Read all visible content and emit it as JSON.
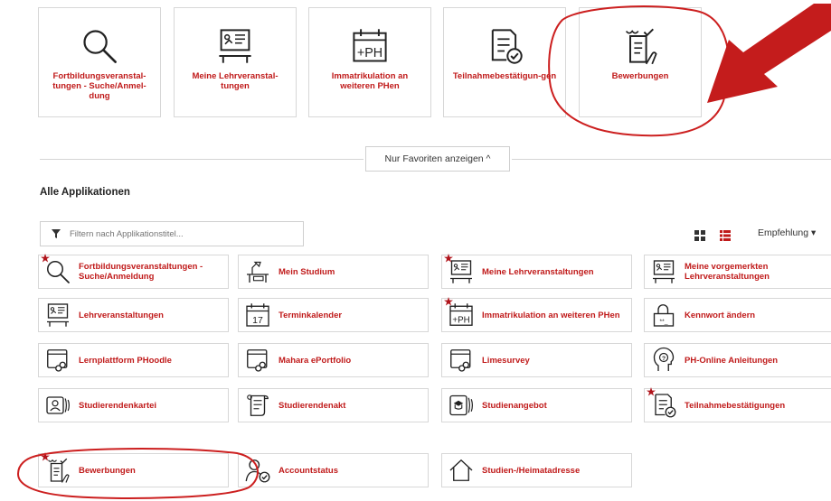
{
  "favorites": [
    {
      "label": "Fortbildungsveranstal-tungen - Suche/Anmel-dung",
      "icon": "magnifier-icon"
    },
    {
      "label": "Meine Lehrveranstal-tungen",
      "icon": "lecture-board-icon"
    },
    {
      "label": "Immatrikulation an weiteren PHen",
      "icon": "plus-ph-calendar-icon"
    },
    {
      "label": "Teilnahmebestätigun-gen",
      "icon": "certificate-check-icon"
    },
    {
      "label": "Bewerbungen",
      "icon": "application-form-icon"
    }
  ],
  "toggle_label": "Nur Favoriten anzeigen ^",
  "section_title": "Alle Applikationen",
  "filter_placeholder": "Filtern nach Applikationstitel...",
  "sort_label": "Empfehlung ▾",
  "apps": [
    {
      "label": "Fortbildungsveranstaltungen - Suche/Anmeldung",
      "icon": "magnifier-icon",
      "favorite": true
    },
    {
      "label": "Mein Studium",
      "icon": "desk-lamp-icon",
      "favorite": false
    },
    {
      "label": "Meine Lehrveranstaltungen",
      "icon": "lecture-board-icon",
      "favorite": true
    },
    {
      "label": "Meine vorgemerkten Lehrveranstaltungen",
      "icon": "lecture-board-icon",
      "favorite": false
    },
    {
      "label": "Lehrveranstaltungen",
      "icon": "lecture-board-icon",
      "favorite": false
    },
    {
      "label": "Terminkalender",
      "icon": "calendar-icon",
      "favorite": false
    },
    {
      "label": "Immatrikulation an weiteren PHen",
      "icon": "plus-ph-calendar-icon",
      "favorite": true
    },
    {
      "label": "Kennwort ändern",
      "icon": "padlock-icon",
      "favorite": false
    },
    {
      "label": "Lernplattform PHoodle",
      "icon": "window-link-icon",
      "favorite": false
    },
    {
      "label": "Mahara ePortfolio",
      "icon": "window-link-icon",
      "favorite": false
    },
    {
      "label": "Limesurvey",
      "icon": "window-link-icon",
      "favorite": false
    },
    {
      "label": "PH-Online Anleitungen",
      "icon": "head-question-icon",
      "favorite": false
    },
    {
      "label": "Studierendenkartei",
      "icon": "id-cards-icon",
      "favorite": false
    },
    {
      "label": "Studierendenakt",
      "icon": "scroll-list-icon",
      "favorite": false
    },
    {
      "label": "Studienangebot",
      "icon": "graduation-cards-icon",
      "favorite": false
    },
    {
      "label": "Teilnahmebestätigungen",
      "icon": "certificate-check-icon",
      "favorite": true
    },
    {
      "label": "Bewerbungen",
      "icon": "application-form-icon",
      "favorite": true
    },
    {
      "label": "Accountstatus",
      "icon": "user-check-icon",
      "favorite": false
    },
    {
      "label": "Studien-/Heimatadresse",
      "icon": "house-icon",
      "favorite": false
    }
  ],
  "colors": {
    "accent": "#c01a1a",
    "annotation": "#cc1f1f",
    "border": "#d7d7d7"
  }
}
